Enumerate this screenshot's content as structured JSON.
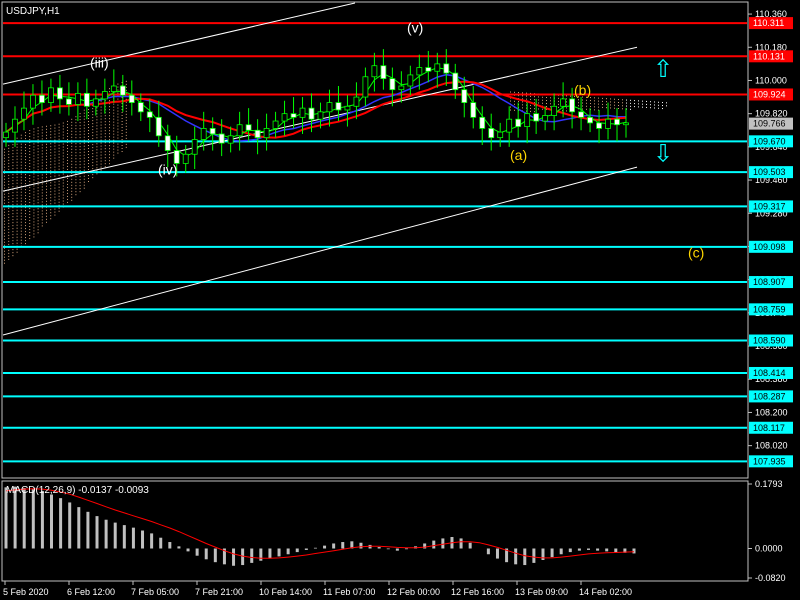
{
  "chart_data": [
    {
      "type": "candlestick",
      "symbol_label": "USDJPY,H1",
      "ylim": [
        107.85,
        110.42
      ],
      "y_ticks": [
        110.36,
        110.18,
        110.0,
        109.82,
        109.64,
        109.46,
        109.28,
        109.1,
        108.92,
        108.74,
        108.56,
        108.38,
        108.2,
        108.02
      ],
      "x_tick_labels": [
        "5 Feb 2020",
        "6 Feb 12:00",
        "7 Feb 05:00",
        "7 Feb 21:00",
        "10 Feb 14:00",
        "11 Feb 07:00",
        "12 Feb 00:00",
        "12 Feb 16:00",
        "13 Feb 09:00",
        "14 Feb 02:00"
      ],
      "current_price": "109.766",
      "colors": {
        "background": "#000000",
        "bull_body": "#000000",
        "bear_body": "#ffffff",
        "bar": "#00ff00",
        "resistance": "#ff0000",
        "support": "#00ffff",
        "channel": "#ffffff",
        "ma_fast": "#00ff00",
        "ma_slow": "#ff0000",
        "ma_blue": "#3333ff",
        "cloud": "#d2a27a",
        "wave_label_white": "#ffffff",
        "wave_label_yellow": "#ffd700"
      },
      "resistance_levels": [
        {
          "value": 110.311,
          "label": "110.311"
        },
        {
          "value": 110.131,
          "label": "110.131"
        },
        {
          "value": 109.924,
          "label": "109.924"
        }
      ],
      "support_levels": [
        {
          "value": 109.67,
          "label": "109.670"
        },
        {
          "value": 109.503,
          "label": "109.503"
        },
        {
          "value": 109.317,
          "label": "109.317"
        },
        {
          "value": 109.098,
          "label": "109.098"
        },
        {
          "value": 108.907,
          "label": "108.907"
        },
        {
          "value": 108.759,
          "label": "108.759"
        },
        {
          "value": 108.59,
          "label": "108.590"
        },
        {
          "value": 108.414,
          "label": "108.414"
        },
        {
          "value": 108.287,
          "label": "108.287"
        },
        {
          "value": 108.117,
          "label": "108.117"
        },
        {
          "value": 107.935,
          "label": "107.935"
        }
      ],
      "wave_labels": [
        {
          "text": "(iii)",
          "color": "white"
        },
        {
          "text": "(iv)",
          "color": "white"
        },
        {
          "text": "(v)",
          "color": "white"
        },
        {
          "text": "(a)",
          "color": "yellow"
        },
        {
          "text": "(b)",
          "color": "yellow"
        },
        {
          "text": "(c)",
          "color": "yellow"
        }
      ],
      "arrows": [
        {
          "direction": "up",
          "glyph": "⇧",
          "color": "#00ffff"
        },
        {
          "direction": "down",
          "glyph": "⇩",
          "color": "#00ffff"
        }
      ],
      "price_series": [
        109.72,
        109.79,
        109.85,
        109.92,
        109.88,
        109.96,
        109.9,
        109.87,
        109.93,
        109.86,
        109.9,
        109.94,
        109.97,
        109.92,
        109.88,
        109.83,
        109.8,
        109.7,
        109.62,
        109.55,
        109.6,
        109.68,
        109.74,
        109.71,
        109.66,
        109.7,
        109.76,
        109.73,
        109.69,
        109.74,
        109.78,
        109.82,
        109.8,
        109.85,
        109.79,
        109.83,
        109.88,
        109.84,
        109.86,
        109.91,
        110.02,
        110.08,
        110.01,
        109.95,
        109.97,
        110.03,
        110.07,
        110.05,
        110.09,
        110.04,
        109.95,
        109.88,
        109.8,
        109.74,
        109.69,
        109.72,
        109.79,
        109.75,
        109.82,
        109.78,
        109.81,
        109.86,
        109.9,
        109.83,
        109.8,
        109.77,
        109.74,
        109.79,
        109.76,
        109.77
      ]
    },
    {
      "type": "histogram",
      "title": "MACD(12,26,9) -0.0137 -0.0093",
      "ylim": [
        -0.082,
        0.1793
      ],
      "y_ticks": [
        "0.1793",
        "0.0000",
        "-0.0820"
      ],
      "main_values": [
        0.17,
        0.172,
        0.168,
        0.165,
        0.16,
        0.15,
        0.14,
        0.128,
        0.115,
        0.102,
        0.09,
        0.08,
        0.072,
        0.065,
        0.058,
        0.05,
        0.042,
        0.03,
        0.018,
        0.006,
        -0.008,
        -0.02,
        -0.03,
        -0.038,
        -0.044,
        -0.048,
        -0.046,
        -0.04,
        -0.034,
        -0.028,
        -0.022,
        -0.016,
        -0.01,
        -0.004,
        0.002,
        0.008,
        0.014,
        0.018,
        0.02,
        0.016,
        0.01,
        0.004,
        -0.002,
        -0.006,
        -0.002,
        0.006,
        0.014,
        0.022,
        0.028,
        0.032,
        0.028,
        0.016,
        0.0,
        -0.016,
        -0.028,
        -0.038,
        -0.044,
        -0.046,
        -0.04,
        -0.032,
        -0.024,
        -0.016,
        -0.01,
        -0.006,
        -0.004,
        -0.006,
        -0.008,
        -0.01,
        -0.012,
        -0.0137
      ],
      "signal_values": [
        0.16,
        0.163,
        0.165,
        0.166,
        0.165,
        0.162,
        0.157,
        0.151,
        0.143,
        0.134,
        0.125,
        0.116,
        0.107,
        0.099,
        0.091,
        0.083,
        0.075,
        0.066,
        0.057,
        0.047,
        0.036,
        0.025,
        0.014,
        0.004,
        -0.006,
        -0.015,
        -0.021,
        -0.025,
        -0.027,
        -0.027,
        -0.026,
        -0.024,
        -0.021,
        -0.018,
        -0.014,
        -0.01,
        -0.006,
        -0.002,
        0.002,
        0.005,
        0.006,
        0.006,
        0.005,
        0.003,
        0.002,
        0.002,
        0.004,
        0.008,
        0.012,
        0.016,
        0.019,
        0.019,
        0.016,
        0.01,
        0.003,
        -0.005,
        -0.013,
        -0.02,
        -0.024,
        -0.026,
        -0.026,
        -0.024,
        -0.021,
        -0.018,
        -0.015,
        -0.013,
        -0.012,
        -0.011,
        -0.01,
        -0.0093
      ]
    }
  ]
}
